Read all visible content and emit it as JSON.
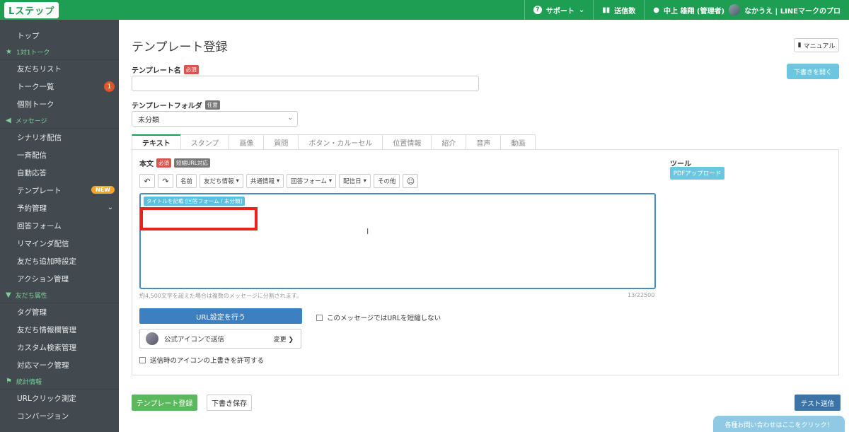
{
  "topbar": {
    "logo": "Lステップ",
    "support": "サポート",
    "send_count": "送信数",
    "user": "中上 雄翔 (管理者)",
    "account": "なかうえ | LINEマークのプロ"
  },
  "sidebar": {
    "top": "トップ",
    "section_talk": "1対1トーク",
    "friends_list": "友だちリスト",
    "talk_list": "トーク一覧",
    "talk_list_badge": "1",
    "individual_talk": "個別トーク",
    "section_message": "メッセージ",
    "scenario": "シナリオ配信",
    "broadcast": "一斉配信",
    "auto_reply": "自動応答",
    "template": "テンプレート",
    "template_badge": "NEW",
    "reservation": "予約管理",
    "answer_form": "回答フォーム",
    "reminder": "リマインダ配信",
    "friend_add": "友だち追加時設定",
    "action": "アクション管理",
    "section_attr": "友だち属性",
    "tag": "タグ管理",
    "friend_info": "友だち情報欄管理",
    "custom_search": "カスタム検索管理",
    "mark": "対応マーク管理",
    "section_stats": "統計情報",
    "url_click": "URLクリック測定",
    "conversion": "コンバージョン"
  },
  "main": {
    "title": "テンプレート登録",
    "manual": "マニュアル",
    "open_draft": "下書きを開く",
    "name_label": "テンプレート名",
    "required": "必須",
    "folder_label": "テンプレートフォルダ",
    "optional": "任意",
    "folder_value": "未分類",
    "tabs": [
      "テキスト",
      "スタンプ",
      "画像",
      "質問",
      "ボタン・カルーセル",
      "位置情報",
      "紹介",
      "音声",
      "動画"
    ],
    "body_label": "本文",
    "short_url": "短縮URL対応",
    "toolbar": {
      "name": "名前",
      "friend_info": "友だち情報",
      "shared_info": "共通情報",
      "answer_form": "回答フォーム",
      "delivery_date": "配信日",
      "other": "その他"
    },
    "tag_chip": "タイトルを記載 [回答フォーム / 未分類]",
    "hint": "約4,500文字を超えた場合は複数のメッセージに分割されます。",
    "count": "13/22500",
    "url_setting": "URL設定を行う",
    "no_shorten": "このメッセージではURLを短縮しない",
    "official_icon": "公式アイコンで送信",
    "change": "変更",
    "allow_override": "送信時のアイコンの上書きを許可する",
    "tools": "ツール",
    "pdf_upload": "PDFアップロード",
    "register": "テンプレート登録",
    "save_draft": "下書き保存",
    "test_send": "テスト送信",
    "contact": "各種お問い合わせはここをクリック！"
  }
}
